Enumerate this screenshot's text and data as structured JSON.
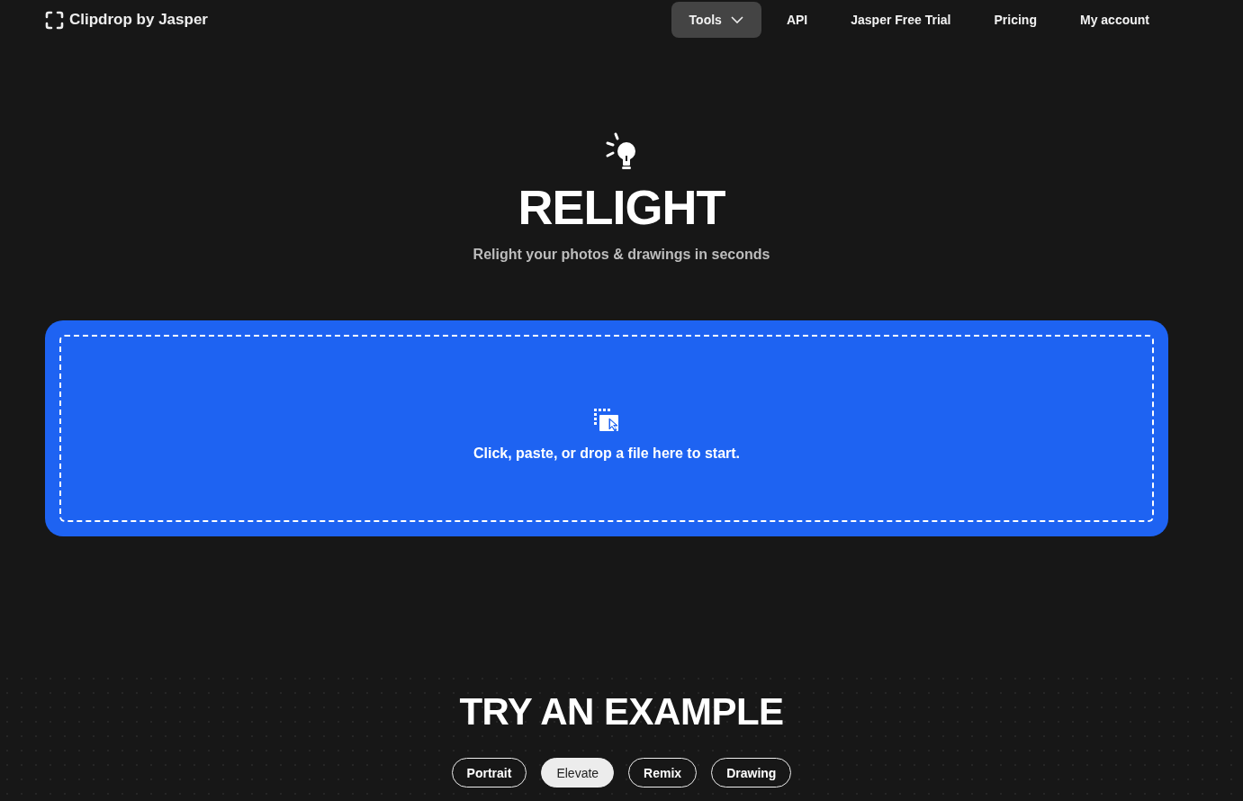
{
  "header": {
    "logo": "Clipdrop by Jasper",
    "nav": [
      {
        "label": "Tools",
        "kind": "dropdown",
        "selected": true
      },
      {
        "label": "API",
        "kind": "link",
        "selected": false
      },
      {
        "label": "Jasper Free Trial",
        "kind": "link",
        "selected": false
      },
      {
        "label": "Pricing",
        "kind": "link",
        "selected": false
      },
      {
        "label": "My account",
        "kind": "link",
        "selected": false
      }
    ]
  },
  "hero": {
    "title": "RELIGHT",
    "subtitle": "Relight your photos & drawings in seconds"
  },
  "dropzone": {
    "text": "Click, paste, or drop a file here to start."
  },
  "examples": {
    "title": "TRY AN EXAMPLE",
    "chips": [
      {
        "label": "Portrait",
        "selected": false
      },
      {
        "label": "Elevate",
        "selected": true
      },
      {
        "label": "Remix",
        "selected": false
      },
      {
        "label": "Drawing",
        "selected": false
      }
    ]
  }
}
